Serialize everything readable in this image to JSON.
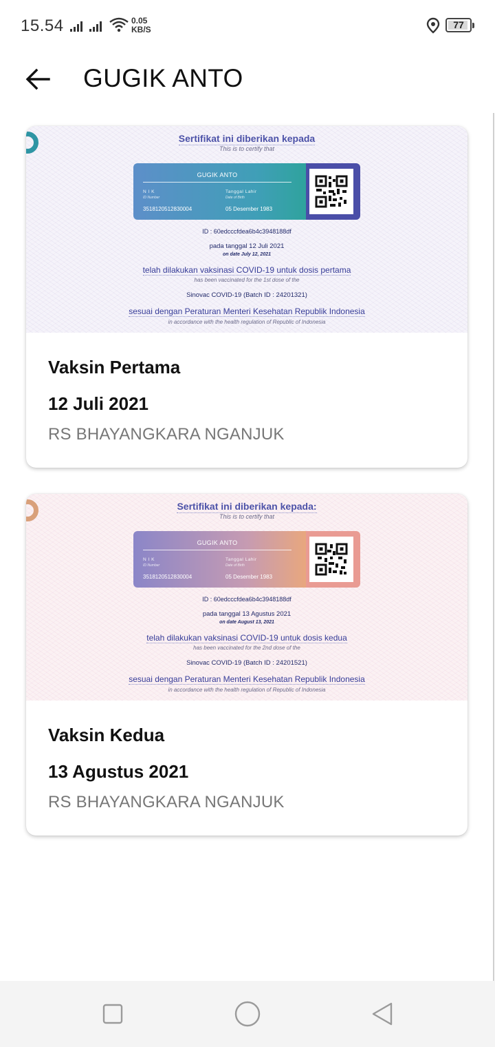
{
  "status_bar": {
    "time": "15.54",
    "net_speed_value": "0.05",
    "net_speed_unit": "KB/S",
    "battery": "77"
  },
  "app_bar": {
    "title": "GUGIK ANTO"
  },
  "certificates": [
    {
      "heading": "Sertifikat ini diberikan kepada",
      "heading_en": "This is to certify that",
      "name": "GUGIK ANTO",
      "nik_label": "N I K",
      "nik_label_en": "ID Number",
      "nik_value": "3518120512830004",
      "dob_label": "Tanggal Lahir",
      "dob_label_en": "Date of Birth",
      "dob_value": "05 Desember 1983",
      "cert_id": "ID : 60edcccfdea6b4c3948188df",
      "date_line": "pada tanggal 12 Juli 2021",
      "date_line_en": "on date July 12, 2021",
      "vaccinated_line": "telah dilakukan vaksinasi COVID-19 untuk dosis pertama",
      "vaccinated_line_en": "has been vaccinated for the 1st dose of the",
      "vaccine": "Sinovac COVID-19 (Batch ID : 24201321)",
      "regulation": "sesuai dengan Peraturan Menteri Kesehatan Republik Indonesia",
      "regulation_en": "in accordance with the health regulation of Republic of Indonesia",
      "dose_title": "Vaksin Pertama",
      "dose_date": "12 Juli 2021",
      "place": "RS BHAYANGKARA NGANJUK"
    },
    {
      "heading": "Sertifikat ini diberikan kepada:",
      "heading_en": "This is to certify that",
      "name": "GUGIK ANTO",
      "nik_label": "N I K",
      "nik_label_en": "ID Number",
      "nik_value": "3518120512830004",
      "dob_label": "Tanggal Lahir",
      "dob_label_en": "Date of Birth",
      "dob_value": "05 Desember 1983",
      "cert_id": "ID : 60edcccfdea6b4c3948188df",
      "date_line": "pada tanggal 13 Agustus 2021",
      "date_line_en": "on date August 13, 2021",
      "vaccinated_line": "telah dilakukan vaksinasi COVID-19 untuk dosis kedua",
      "vaccinated_line_en": "has been vaccinated for the 2nd dose of the",
      "vaccine": "Sinovac COVID-19 (Batch ID : 24201521)",
      "regulation": "sesuai dengan Peraturan Menteri Kesehatan Republik Indonesia",
      "regulation_en": "in accordance with the health regulation of Republic of Indonesia",
      "dose_title": "Vaksin Kedua",
      "dose_date": "13 Agustus 2021",
      "place": "RS BHAYANGKARA NGANJUK"
    }
  ],
  "icons": {
    "back": "arrow-left-icon",
    "location": "location-pin-icon",
    "wifi": "wifi-icon",
    "nav_recent": "square-icon",
    "nav_home": "circle-icon",
    "nav_back": "triangle-back-icon"
  },
  "colors": {
    "card1_accent": "#2e95a4",
    "card2_accent": "#e8a77e",
    "heading_text": "#4c52a8"
  }
}
